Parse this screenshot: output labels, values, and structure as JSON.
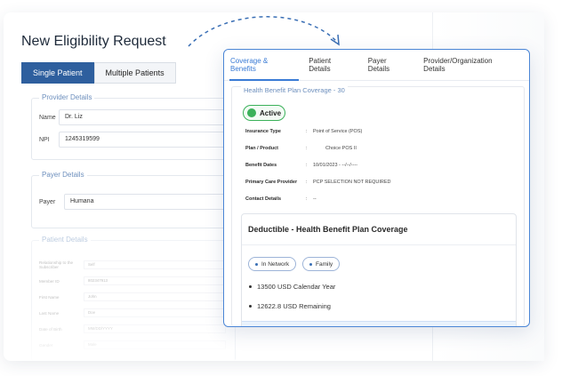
{
  "background": {
    "title": "New Eligibility Request",
    "tabs": [
      {
        "label": "Single Patient",
        "active": true
      },
      {
        "label": "Multiple Patients",
        "active": false
      }
    ],
    "provider": {
      "legend": "Provider Details",
      "name_label": "Name",
      "name_value": "Dr. Liz",
      "npi_label": "NPI",
      "npi_value": "1245319599"
    },
    "payer": {
      "legend": "Payer Details",
      "payer_label": "Payer",
      "payer_value": "Humana"
    },
    "patient": {
      "legend": "Patient Details",
      "rows": [
        {
          "label": "Relationship to the Subscriber",
          "value": "Self"
        },
        {
          "label": "Member ID",
          "value": "802347913"
        },
        {
          "label": "First Name",
          "value": "John"
        },
        {
          "label": "Last Name",
          "value": "Doe"
        },
        {
          "label": "Date of Birth",
          "value": "MM/DD/YYYY"
        },
        {
          "label": "Gender",
          "value": "Male"
        }
      ]
    }
  },
  "modal": {
    "tabs": [
      {
        "label": "Coverage & Benefits",
        "active": true
      },
      {
        "label": "Patient Details",
        "active": false
      },
      {
        "label": "Payer Details",
        "active": false
      },
      {
        "label": "Provider/Organization Details",
        "active": false
      }
    ],
    "plan_title": "Health Benefit Plan Coverage - 30",
    "status": "Active",
    "info": [
      {
        "key": "Insurance Type",
        "sep": ":",
        "value": "Point of Service (POS)"
      },
      {
        "key": "Plan / Product",
        "sep": ":",
        "value": "Choice POS II"
      },
      {
        "key": "Benefit Dates",
        "sep": ":",
        "value": "10/01/2023 - --/--/----"
      },
      {
        "key": "Primary Care Provider",
        "sep": ":",
        "value": "PCP SELECTION NOT REQUIRED"
      },
      {
        "key": "Contact Details",
        "sep": ":",
        "value": "--"
      }
    ],
    "deductible": {
      "title": "Deductible - Health Benefit Plan Coverage",
      "chips": [
        "In Network",
        "Family"
      ],
      "items": [
        "13500 USD Calendar Year",
        "12622.8 USD Remaining"
      ]
    }
  },
  "colors": {
    "accent": "#3a7bd5",
    "tab_active_bg": "#2e5f9e",
    "status_green": "#3bb15a",
    "legend_blue": "#6d8fbd"
  },
  "icons": [
    "dashed-curve-arrow-icon",
    "status-dot-icon",
    "chip-dot-icon",
    "bullet-dot-icon"
  ]
}
